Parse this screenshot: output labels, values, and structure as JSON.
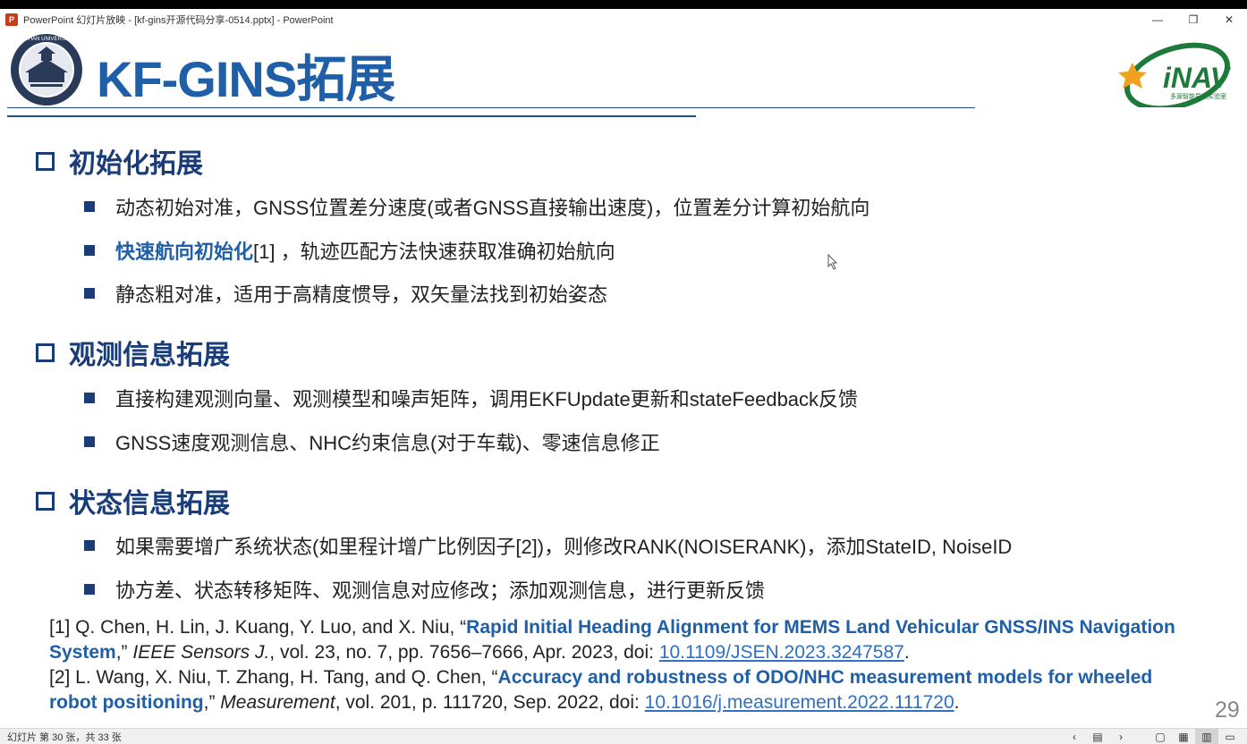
{
  "window": {
    "app_icon_letter": "P",
    "title": "PowerPoint 幻灯片放映 - [kf-gins开源代码分享-0514.pptx] - PowerPoint",
    "minimize": "—",
    "restore": "❐",
    "close": "✕"
  },
  "slide": {
    "title": "KF-GINS拓展",
    "sections": [
      {
        "heading": "初始化拓展",
        "bullets": [
          {
            "pre": "",
            "highlight": "",
            "text": "动态初始对准，GNSS位置差分速度(或者GNSS直接输出速度)，位置差分计算初始航向"
          },
          {
            "pre": "",
            "highlight": "快速航向初始化",
            "text": "[1] ，轨迹匹配方法快速获取准确初始航向"
          },
          {
            "pre": "",
            "highlight": "",
            "text": "静态粗对准，适用于高精度惯导，双矢量法找到初始姿态"
          }
        ]
      },
      {
        "heading": "观测信息拓展",
        "bullets": [
          {
            "highlight": "",
            "text": "直接构建观测向量、观测模型和噪声矩阵，调用EKFUpdate更新和stateFeedback反馈"
          },
          {
            "highlight": "",
            "text": "GNSS速度观测信息、NHC约束信息(对于车载)、零速信息修正"
          }
        ]
      },
      {
        "heading": "状态信息拓展",
        "bullets": [
          {
            "highlight": "",
            "text": "如果需要增广系统状态(如里程计增广比例因子[2])，则修改RANK(NOISERANK)，添加StateID, NoiseID"
          },
          {
            "highlight": "",
            "text": "协方差、状态转移矩阵、观测信息对应修改；添加观测信息，进行更新反馈"
          }
        ]
      }
    ],
    "references": [
      {
        "prefix": "[1] Q. Chen, H. Lin, J. Kuang, Y. Luo, and X. Niu, “",
        "title": "Rapid Initial Heading Alignment for MEMS Land Vehicular GNSS/INS Navigation System",
        "mid": ",” ",
        "journal": "IEEE Sensors J.",
        "details": ", vol. 23, no. 7, pp. 7656–7666, Apr. 2023, doi: ",
        "doi": "10.1109/JSEN.2023.3247587",
        "end": "."
      },
      {
        "prefix": "[2] L. Wang, X. Niu, T. Zhang, H. Tang, and Q. Chen, “",
        "title": "Accuracy and robustness of ODO/NHC measurement models for wheeled robot positioning",
        "mid": ",” ",
        "journal": "Measurement",
        "details": ", vol. 201, p. 111720, Sep. 2022, doi: ",
        "doi": "10.1016/j.measurement.2022.111720",
        "end": "."
      }
    ],
    "page_number": "29",
    "logo_right_text": "iNAV",
    "logo_right_subtitle": "多源智能导航实验室",
    "logo_left_caption": "WUHAN UNIVERSITY"
  },
  "statusbar": {
    "text": "幻灯片 第 30 张，共 33 张",
    "prev_icon": "‹",
    "menu_icon": "▤",
    "next_icon": "›",
    "normal_view_icon": "▢",
    "sorter_view_icon": "▦",
    "reading_view_icon": "▥",
    "slideshow_icon": "▭"
  },
  "colors": {
    "title_blue": "#1f5fa8",
    "heading_navy": "#1a3d7a",
    "link_blue": "#2f6fc4"
  }
}
